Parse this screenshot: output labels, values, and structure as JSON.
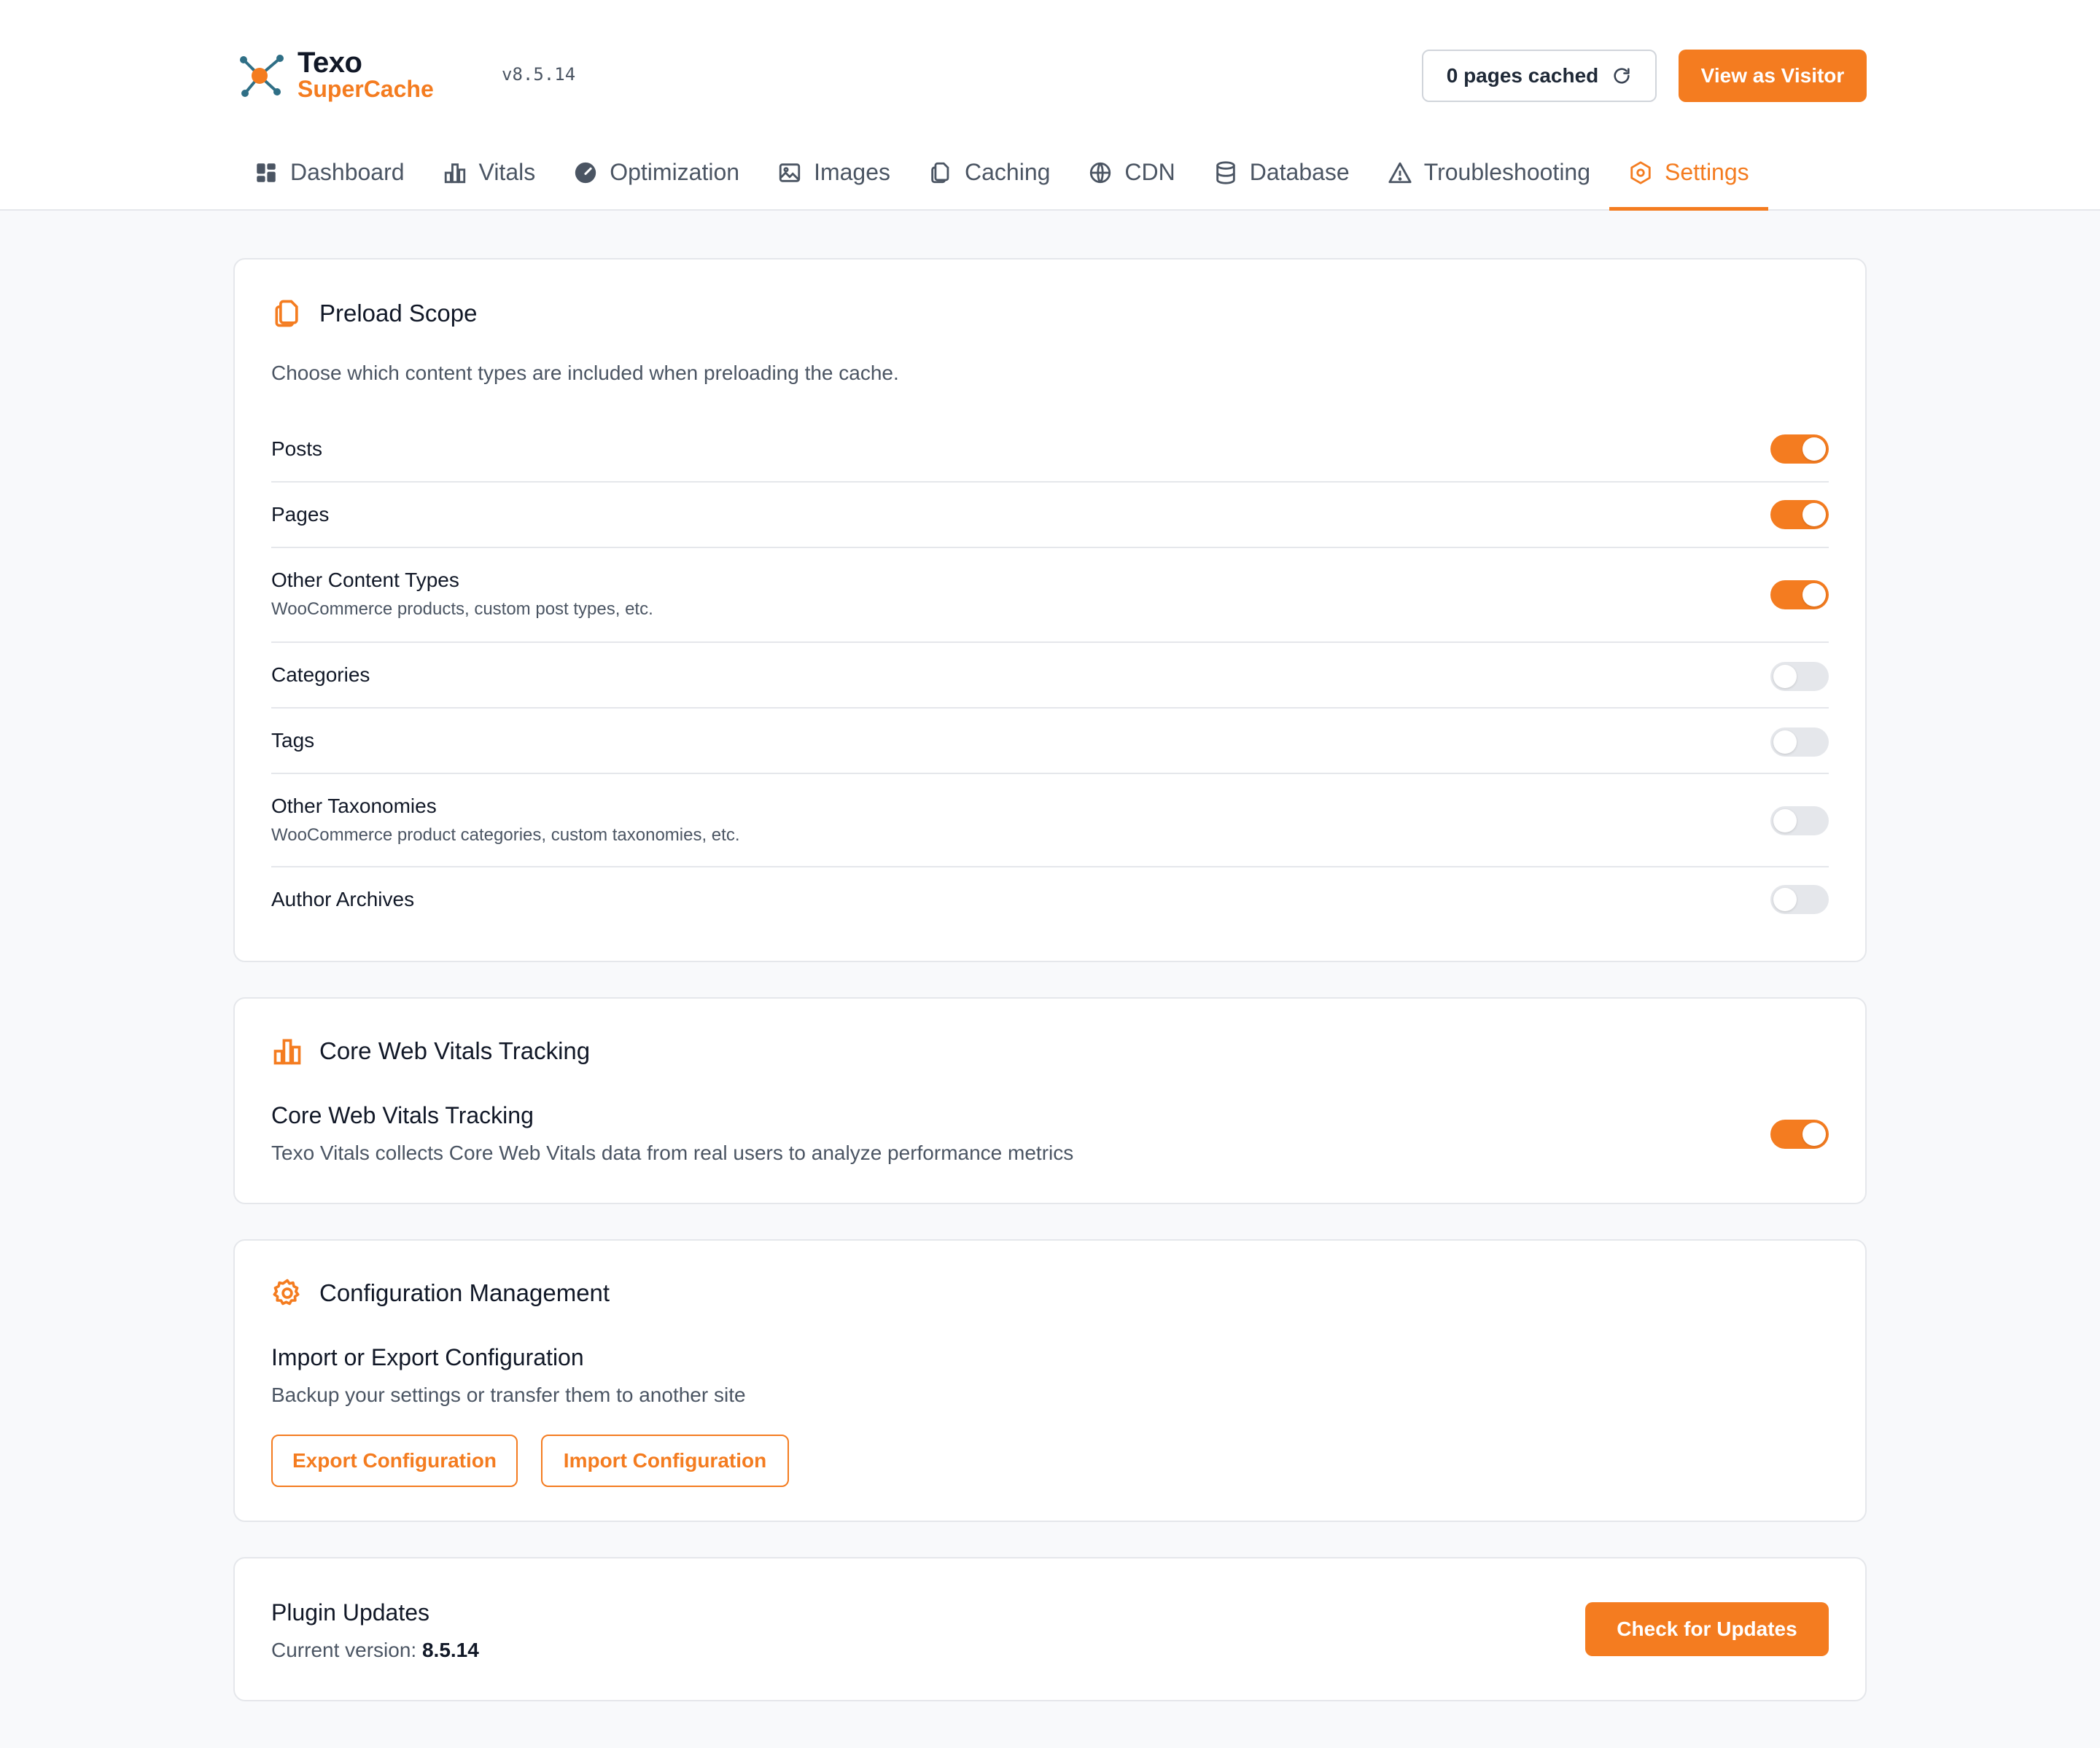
{
  "brand": {
    "name": "Texo",
    "sub": "SuperCache",
    "version": "v8.5.14"
  },
  "header": {
    "cached_label": "0 pages cached",
    "visitor_label": "View as Visitor"
  },
  "tabs": [
    {
      "label": "Dashboard",
      "icon": "dashboard-icon"
    },
    {
      "label": "Vitals",
      "icon": "bar-chart-icon"
    },
    {
      "label": "Optimization",
      "icon": "gauge-icon"
    },
    {
      "label": "Images",
      "icon": "image-icon"
    },
    {
      "label": "Caching",
      "icon": "copy-icon"
    },
    {
      "label": "CDN",
      "icon": "globe-icon"
    },
    {
      "label": "Database",
      "icon": "database-icon"
    },
    {
      "label": "Troubleshooting",
      "icon": "warning-icon"
    },
    {
      "label": "Settings",
      "icon": "settings-icon",
      "active": true
    }
  ],
  "preload": {
    "title": "Preload Scope",
    "description": "Choose which content types are included when preloading the cache.",
    "items": [
      {
        "label": "Posts",
        "sub": "",
        "enabled": true
      },
      {
        "label": "Pages",
        "sub": "",
        "enabled": true
      },
      {
        "label": "Other Content Types",
        "sub": "WooCommerce products, custom post types, etc.",
        "enabled": true
      },
      {
        "label": "Categories",
        "sub": "",
        "enabled": false
      },
      {
        "label": "Tags",
        "sub": "",
        "enabled": false
      },
      {
        "label": "Other Taxonomies",
        "sub": "WooCommerce product categories, custom taxonomies, etc.",
        "enabled": false
      },
      {
        "label": "Author Archives",
        "sub": "",
        "enabled": false
      }
    ]
  },
  "vitals": {
    "title": "Core Web Vitals Tracking",
    "setting_label": "Core Web Vitals Tracking",
    "setting_desc": "Texo Vitals collects Core Web Vitals data from real users to analyze performance metrics",
    "enabled": true
  },
  "config": {
    "title": "Configuration Management",
    "subtitle": "Import or Export Configuration",
    "desc": "Backup your settings or transfer them to another site",
    "export_label": "Export Configuration",
    "import_label": "Import Configuration"
  },
  "updates": {
    "title": "Plugin Updates",
    "current_prefix": "Current version:",
    "current_version": "8.5.14",
    "check_label": "Check for Updates"
  },
  "colors": {
    "accent": "#f47c20",
    "toggle_off": "#e5e7eb",
    "logo_teal": "#2f6f86"
  }
}
